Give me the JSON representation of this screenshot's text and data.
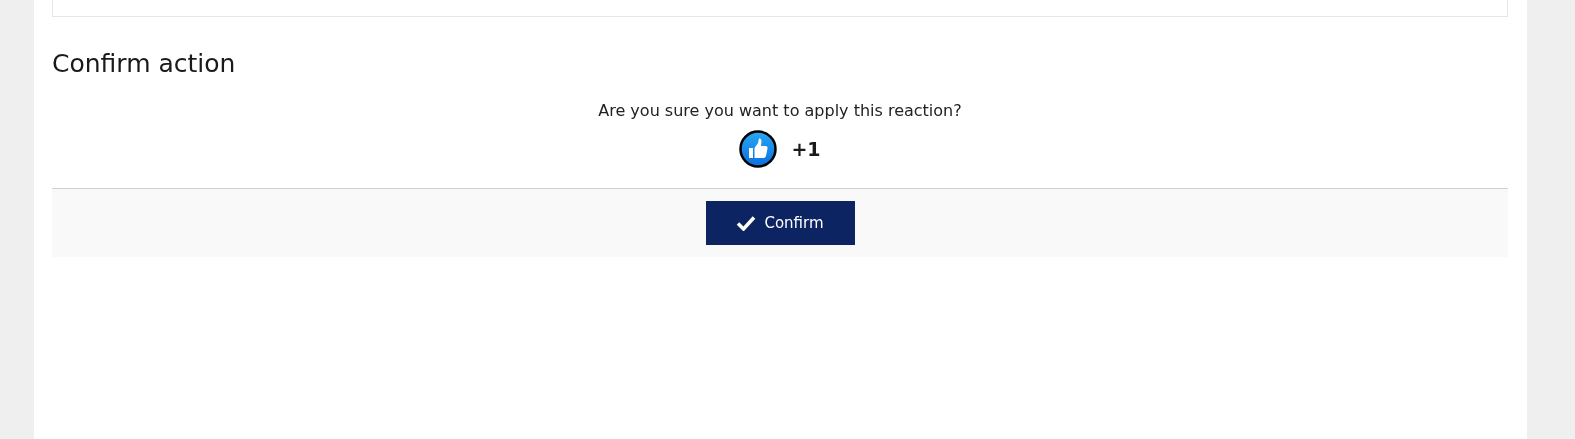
{
  "dialog": {
    "title": "Confirm action",
    "message": "Are you sure you want to apply this reaction?",
    "reaction": {
      "label": "+1"
    },
    "buttons": [
      {
        "label": "Confirm",
        "kind": "confirm"
      }
    ]
  }
}
